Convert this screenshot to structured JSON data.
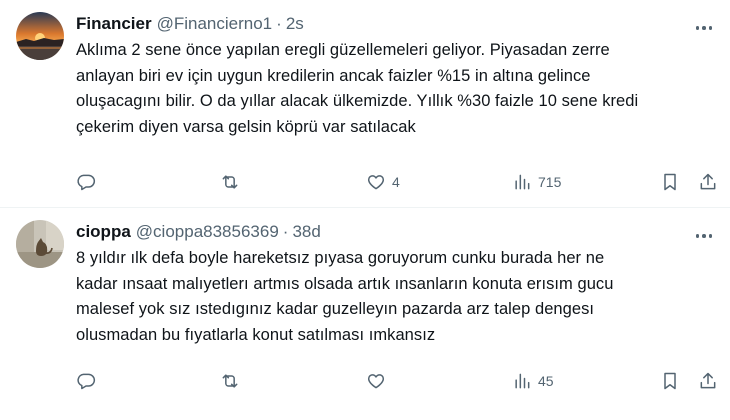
{
  "tweets": [
    {
      "display_name": "Financier",
      "handle": "@Financierno1",
      "separator": "·",
      "time": "2s",
      "avatar_icon": "sunset-avatar",
      "text": "Aklıma 2 sene önce yapılan eregli güzellemeleri geliyor. Piyasadan zerre\nanlayan biri ev için uygun kredilerin ancak faizler %15 in altına gelince\noluşacagını bilir. O da yıllar alacak ülkemizde. Yıllık %30 faizle 10 sene kredi\nçekerim diyen varsa gelsin köprü var satılacak",
      "replies": "",
      "retweets": "",
      "likes": "4",
      "views": "715"
    },
    {
      "display_name": "cioppa",
      "handle": "@cioppa83856369",
      "separator": "·",
      "time": "38d",
      "avatar_icon": "cat-avatar",
      "text": "8 yıldır ılk defa boyle hareketsız pıyasa goruyorum  cunku burada her ne\nkadar ınsaat malıyetlerı artmıs olsada artık ınsanların konuta erısım gucu\nmalesef yok sız ıstedıgınız kadar guzelleyın pazarda arz talep dengesı\nolusmadan bu fıyatlarla konut satılması ımkansız",
      "replies": "",
      "retweets": "",
      "likes": "",
      "views": "45"
    }
  ],
  "colors": {
    "text_primary": "#0f1419",
    "text_secondary": "#536471",
    "divider": "#eff3f4"
  }
}
